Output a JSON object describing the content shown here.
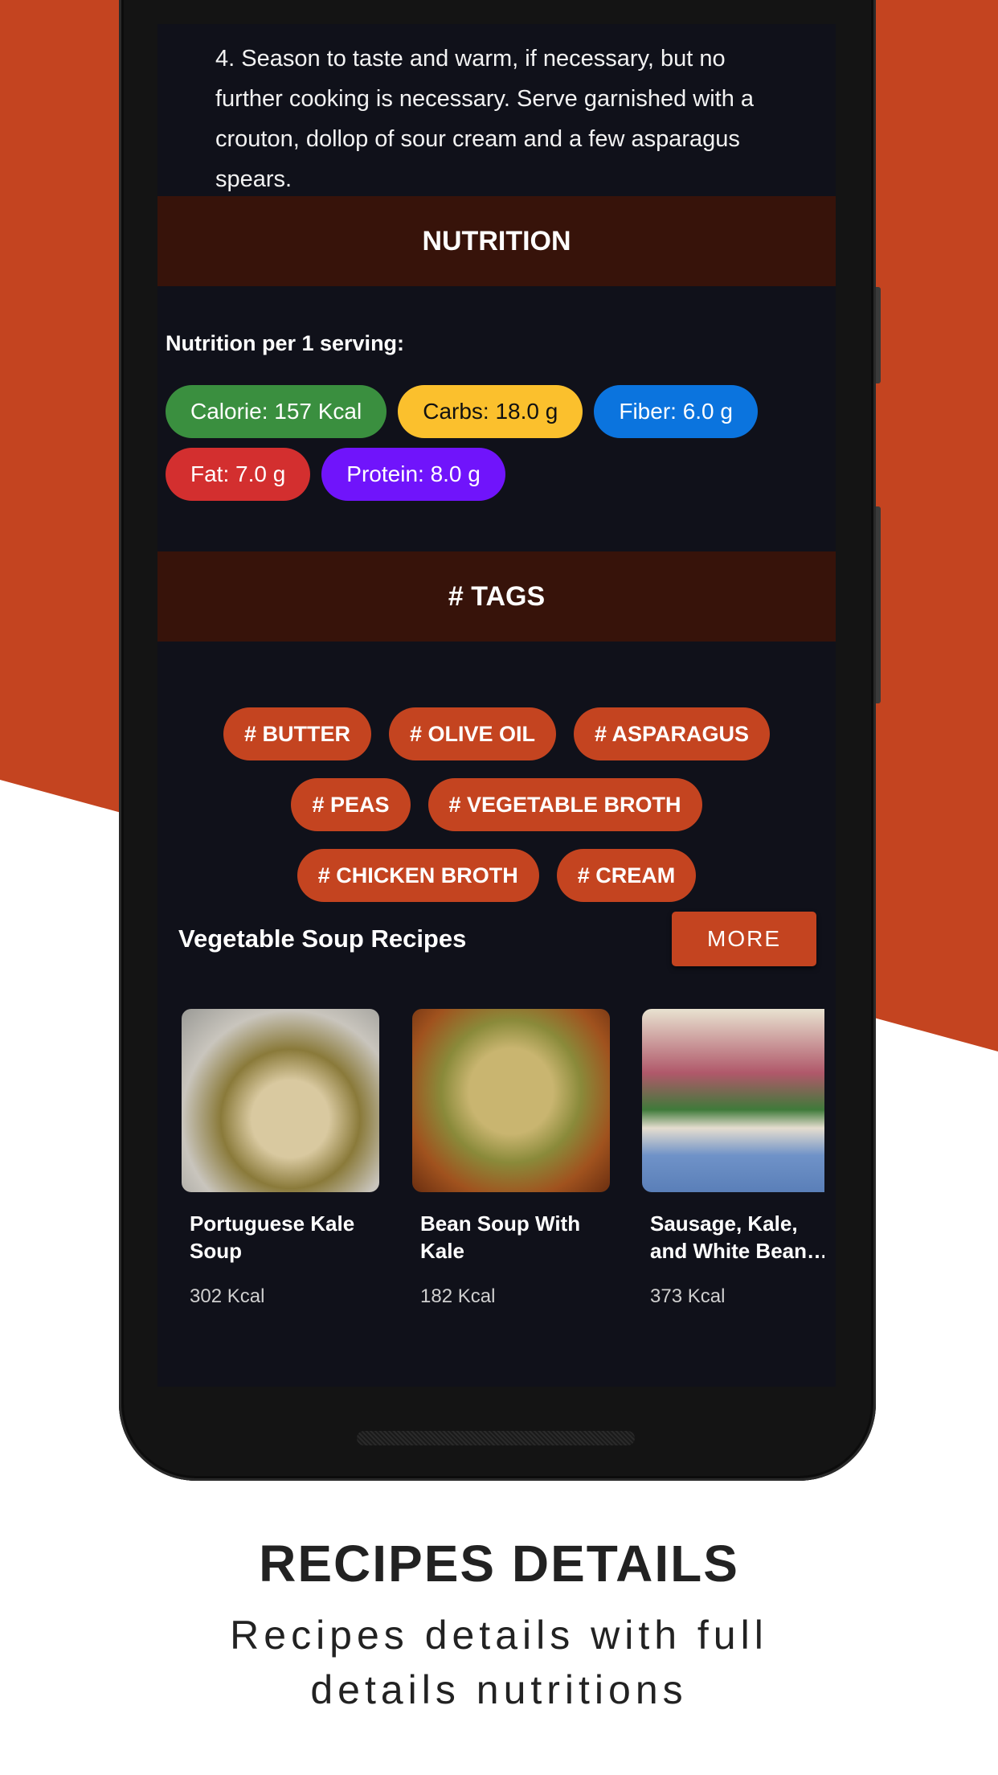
{
  "recipe": {
    "step_text": "4. Season to taste and warm, if necessary, but no further cooking is necessary. Serve garnished with a crouton, dollop of sour cream and a few asparagus spears."
  },
  "nutrition": {
    "header": "NUTRITION",
    "label": "Nutrition per 1 serving:",
    "pills": [
      {
        "text": "Calorie: 157 Kcal",
        "color": "#3a8f3f"
      },
      {
        "text": "Carbs: 18.0 g",
        "color": "#fbc02d"
      },
      {
        "text": "Fiber: 6.0 g",
        "color": "#0b74de"
      },
      {
        "text": "Fat: 7.0 g",
        "color": "#d32f2f"
      },
      {
        "text": "Protein: 8.0 g",
        "color": "#7014fb"
      }
    ]
  },
  "tags": {
    "header": "# TAGS",
    "items": [
      "# BUTTER",
      "# OLIVE OIL",
      "# ASPARAGUS",
      "# PEAS",
      "# VEGETABLE BROTH",
      "# CHICKEN BROTH",
      "# CREAM"
    ]
  },
  "related": {
    "title": "Vegetable Soup Recipes",
    "more_label": "MORE",
    "cards": [
      {
        "title": "Portuguese Kale Soup",
        "kcal": "302 Kcal"
      },
      {
        "title": "Bean Soup With Kale",
        "kcal": "182 Kcal"
      },
      {
        "title": "Sausage, Kale, and White Bean…",
        "kcal": "373 Kcal"
      }
    ]
  },
  "promo": {
    "title": "RECIPES DETAILS",
    "subtitle_line1": "Recipes details with full",
    "subtitle_line2": "details nutritions"
  },
  "colors": {
    "accent": "#c44420",
    "section_header_bg": "#37130a",
    "screen_bg": "#10111a"
  }
}
